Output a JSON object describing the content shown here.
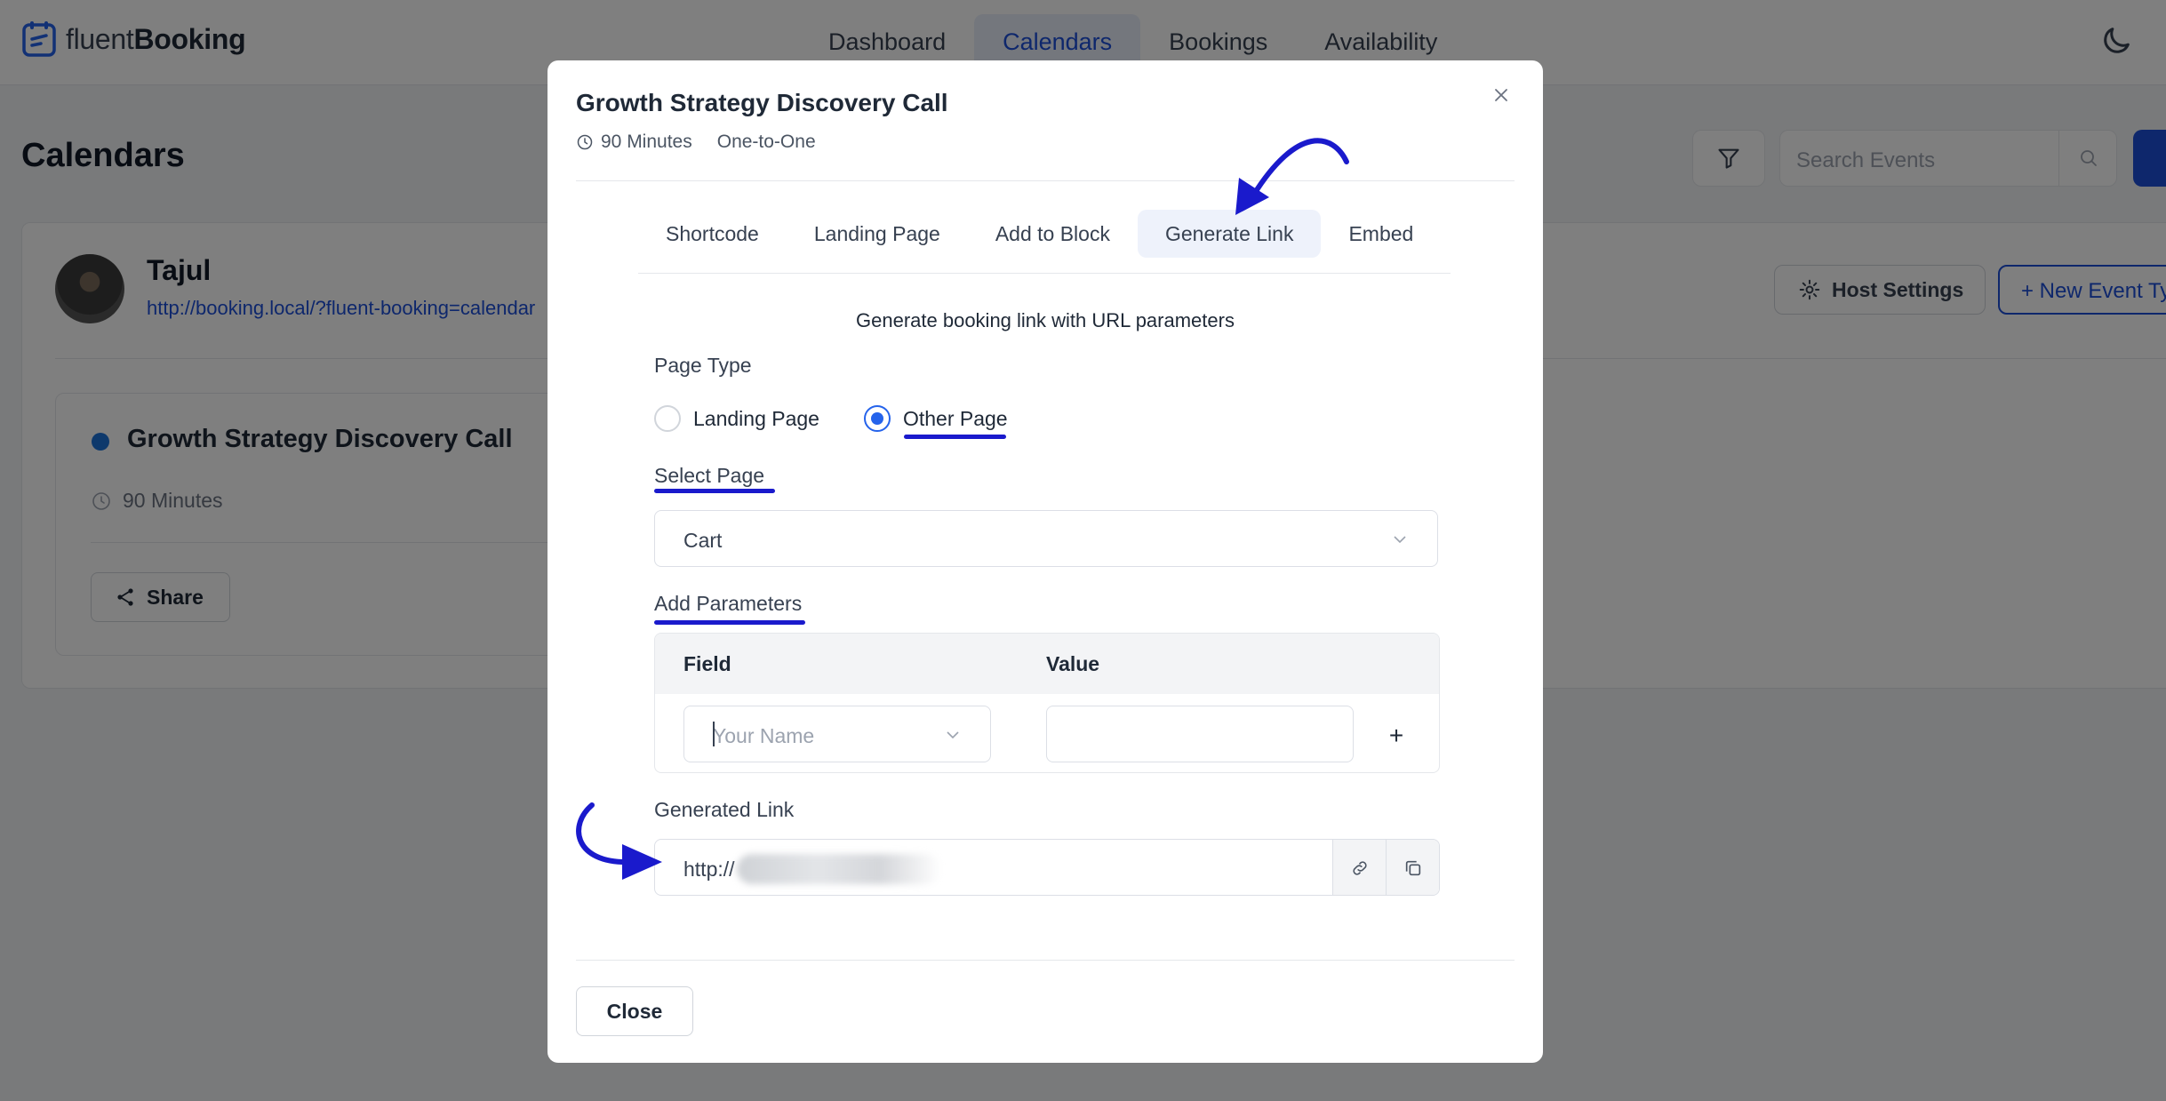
{
  "app": {
    "logo_light": "fluent",
    "logo_bold": "Booking",
    "nav": [
      "Dashboard",
      "Calendars",
      "Bookings",
      "Availability"
    ],
    "active_nav": "Calendars"
  },
  "page": {
    "title": "Calendars",
    "search_placeholder": "Search Events"
  },
  "host": {
    "name": "Tajul",
    "url": "http://booking.local/?fluent-booking=calendar",
    "settings_label": "Host Settings",
    "new_event_label": "+ New Event Ty"
  },
  "event_card": {
    "title": "Growth Strategy Discovery Call",
    "duration": "90 Minutes",
    "share_label": "Share"
  },
  "modal": {
    "title": "Growth Strategy Discovery Call",
    "duration": "90 Minutes",
    "type": "One-to-One",
    "tabs": [
      "Shortcode",
      "Landing Page",
      "Add to Block",
      "Generate Link",
      "Embed"
    ],
    "active_tab": "Generate Link",
    "description": "Generate booking link with URL parameters",
    "page_type_label": "Page Type",
    "page_type_options": [
      "Landing Page",
      "Other Page"
    ],
    "page_type_selected": "Other Page",
    "select_page_label": "Select Page",
    "select_page_value": "Cart",
    "add_params_label": "Add Parameters",
    "params_field_header": "Field",
    "params_value_header": "Value",
    "params_field_placeholder": "Your Name",
    "params_value": "",
    "add_param_symbol": "+",
    "generated_link_label": "Generated Link",
    "generated_link_value": "http://",
    "close_label": "Close"
  },
  "colors": {
    "accent": "#1d4ed8",
    "annotation": "#1a1acc",
    "overlay": "rgba(0,0,0,0.5)"
  }
}
